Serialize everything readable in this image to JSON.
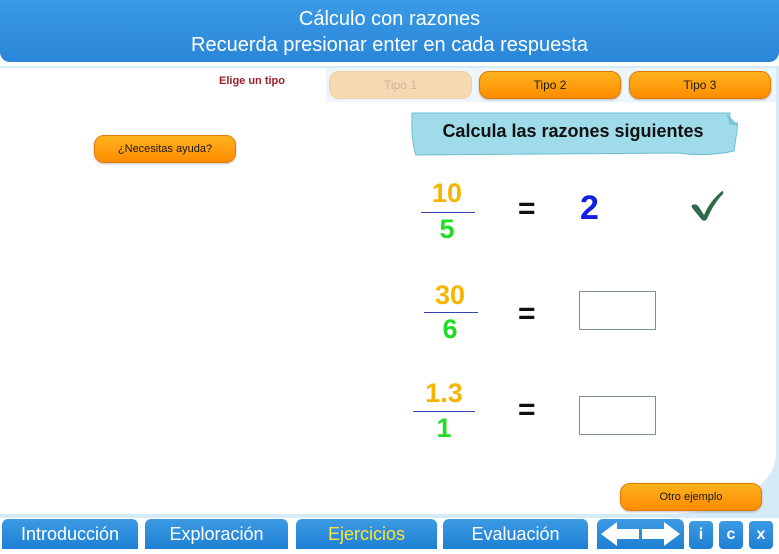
{
  "header": {
    "title": "Cálculo con razones",
    "subtitle": "Recuerda presionar enter en cada respuesta"
  },
  "type_selector": {
    "label": "Elige un tipo",
    "options": [
      "Tipo 1",
      "Tipo 2",
      "Tipo 3"
    ],
    "disabled": "Tipo 1"
  },
  "help_button": "¿Necesitas ayuda?",
  "banner": "Calcula las razones siguientes",
  "exercises": [
    {
      "numerator": "10",
      "denominator": "5",
      "equals": "=",
      "answer": "2",
      "status": "correct"
    },
    {
      "numerator": "30",
      "denominator": "6",
      "equals": "=",
      "answer": ""
    },
    {
      "numerator": "1.3",
      "denominator": "1",
      "equals": "=",
      "answer": ""
    }
  ],
  "other_example_button": "Otro ejemplo",
  "nav": {
    "tabs": [
      "Introducción",
      "Exploración",
      "Ejercicios",
      "Evaluación"
    ],
    "active": "Ejercicios",
    "buttons": [
      "i",
      "c",
      "x"
    ]
  },
  "colors": {
    "header": "#2a86d8",
    "button_orange": "#ff9a10",
    "numerator": "#f5b400",
    "denominator": "#22dd22",
    "answer": "#1020e0",
    "nav_active_text": "#ffe23a",
    "check": "#2f6b4a"
  },
  "icons": {
    "check": "check-icon",
    "arrows": [
      "arrow-left-icon",
      "arrow-right-icon"
    ]
  }
}
